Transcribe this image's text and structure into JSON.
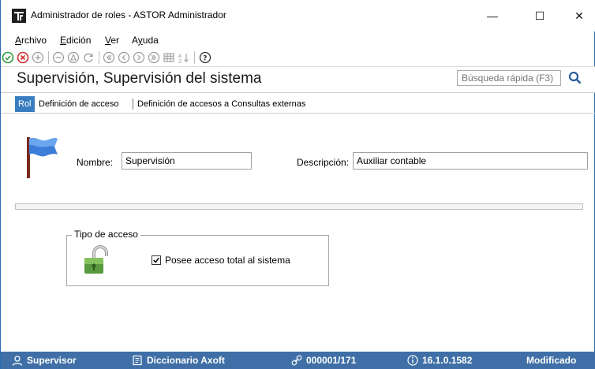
{
  "window": {
    "title": "Administrador de roles - ASTOR Administrador",
    "minimize": "—",
    "maximize": "☐",
    "close": "✕"
  },
  "menu": {
    "items": [
      {
        "underline": "A",
        "rest": "rchivo"
      },
      {
        "underline": "E",
        "rest": "dición"
      },
      {
        "underline": "V",
        "rest": "er"
      },
      {
        "pre": "A",
        "underline": "y",
        "rest": "uda"
      }
    ]
  },
  "toolbar": {
    "icons": [
      "accept-icon",
      "cancel-icon",
      "add-icon",
      "remove-icon",
      "lock-filter-icon",
      "refresh-icon",
      "first-icon",
      "previous-icon",
      "next-icon",
      "last-icon",
      "grid-icon",
      "sort-icon",
      "help-icon"
    ]
  },
  "header": {
    "title": "Supervisión, Supervisión del sistema",
    "search_placeholder": "Búsqueda rápida (F3)"
  },
  "tabs": [
    {
      "label": "Rol",
      "active": true
    },
    {
      "label": "Definición de acceso",
      "active": false
    },
    {
      "label": "Definición de accesos a Consultas externas",
      "active": false
    }
  ],
  "form": {
    "nombre_label": "Nombre:",
    "nombre_value": "Supervisión",
    "descripcion_label": "Descripción:",
    "descripcion_value": "Auxiliar contable"
  },
  "access": {
    "group_title": "Tipo de acceso",
    "checkbox_label": "Posee acceso total al sistema",
    "checked": true
  },
  "status": {
    "user": "Supervisor",
    "dictionary": "Diccionario Axoft",
    "code": "000001/171",
    "version": "16.1.0.1582",
    "state": "Modificado"
  },
  "colors": {
    "accent": "#3a7ec1",
    "statusbar": "#3f6fa6",
    "accept": "#2e9b3a",
    "cancel": "#d32f2f"
  }
}
